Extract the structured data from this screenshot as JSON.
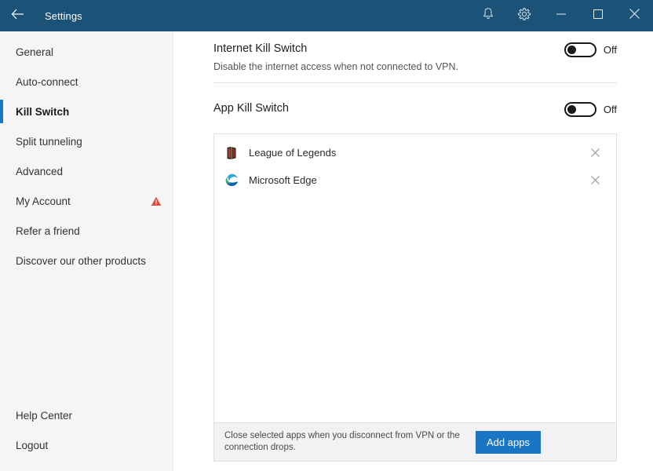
{
  "titlebar": {
    "title": "Settings",
    "back_icon": "back-arrow-icon",
    "bell_icon": "notification-bell-icon",
    "gear_icon": "gear-icon",
    "minimize_icon": "minimize-icon",
    "maximize_icon": "maximize-icon",
    "close_icon": "close-icon",
    "background_color": "#1b5278"
  },
  "sidebar": {
    "items": [
      {
        "label": "General",
        "selected": false,
        "warning": false
      },
      {
        "label": "Auto-connect",
        "selected": false,
        "warning": false
      },
      {
        "label": "Kill Switch",
        "selected": true,
        "warning": false
      },
      {
        "label": "Split tunneling",
        "selected": false,
        "warning": false
      },
      {
        "label": "Advanced",
        "selected": false,
        "warning": false
      },
      {
        "label": "My Account",
        "selected": false,
        "warning": true
      },
      {
        "label": "Refer a friend",
        "selected": false,
        "warning": false
      },
      {
        "label": "Discover our other products",
        "selected": false,
        "warning": false
      }
    ],
    "bottom_items": [
      {
        "label": "Help Center"
      },
      {
        "label": "Logout"
      }
    ],
    "selected_indicator_color": "#1678c2",
    "warning_icon_color": "#e04b41"
  },
  "main": {
    "internet_kill_switch": {
      "title": "Internet Kill Switch",
      "description": "Disable the internet access when not connected to VPN.",
      "toggle_state": "Off"
    },
    "app_kill_switch": {
      "title": "App Kill Switch",
      "toggle_state": "Off"
    },
    "app_list": {
      "apps": [
        {
          "name": "League of Legends",
          "icon": "league-of-legends-icon",
          "remove_icon": "close-icon"
        },
        {
          "name": "Microsoft Edge",
          "icon": "microsoft-edge-icon",
          "remove_icon": "close-icon"
        }
      ]
    },
    "footer": {
      "description": "Close selected apps when you disconnect from VPN or the connection drops.",
      "add_button_label": "Add apps",
      "add_button_color": "#1a76c4"
    }
  }
}
